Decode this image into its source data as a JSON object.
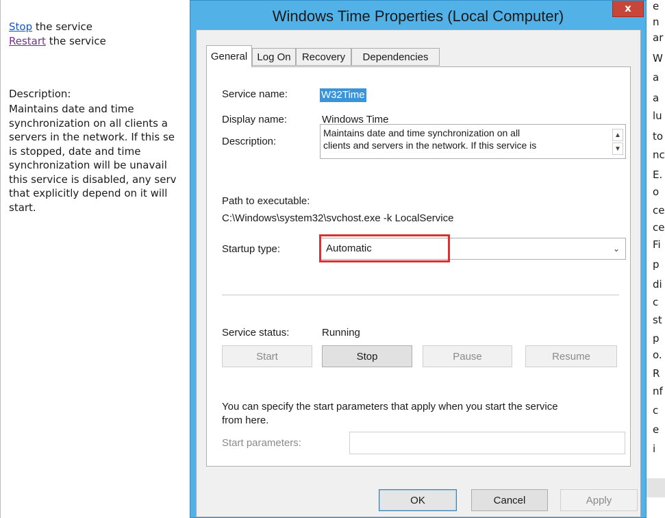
{
  "left_pane": {
    "stop_link": "Stop",
    "stop_suffix": " the service",
    "restart_link": "Restart",
    "restart_suffix": " the service",
    "description_label": "Description:",
    "description_lines": [
      "Maintains date and time",
      "synchronization on all clients a",
      "servers in the network. If this se",
      "is stopped, date and time",
      "synchronization will be unavail",
      "this service is disabled, any serv",
      "that explicitly depend on it will",
      "start."
    ]
  },
  "right_pane": {
    "fragments": [
      "e",
      "n",
      "ar",
      "W",
      "a",
      "a",
      "lu",
      "to",
      "nc",
      "E.",
      "o",
      "ce",
      "ce",
      "Fi",
      "p",
      "di",
      "c",
      "st",
      "p",
      "o.",
      "R",
      "nf",
      "c",
      "e",
      "i"
    ]
  },
  "dialog": {
    "title": "Windows Time Properties (Local Computer)",
    "close_glyph": "x",
    "tabs": [
      {
        "label": "General",
        "active": true
      },
      {
        "label": "Log On",
        "active": false
      },
      {
        "label": "Recovery",
        "active": false
      },
      {
        "label": "Dependencies",
        "active": false
      }
    ],
    "general": {
      "service_name_label": "Service name:",
      "service_name_value": "W32Time",
      "display_name_label": "Display name:",
      "display_name_value": "Windows Time",
      "description_label": "Description:",
      "description_lines": [
        "Maintains date and time synchronization on all",
        "clients and servers in the network. If this service is"
      ],
      "path_label": "Path to executable:",
      "path_value": "C:\\Windows\\system32\\svchost.exe -k LocalService",
      "startup_label": "Startup type:",
      "startup_value": "Automatic",
      "status_label": "Service status:",
      "status_value": "Running",
      "buttons": {
        "start": "Start",
        "stop": "Stop",
        "pause": "Pause",
        "resume": "Resume"
      },
      "help_text_lines": [
        "You can specify the start parameters that apply when you start the service",
        "from here."
      ],
      "start_params_label": "Start parameters:",
      "start_params_value": ""
    },
    "footer": {
      "ok": "OK",
      "cancel": "Cancel",
      "apply": "Apply"
    }
  },
  "colors": {
    "title_bar": "#52b2e8",
    "close_button": "#c7463a",
    "selection": "#3a94d9",
    "highlight": "#d83035",
    "link": "#1155cc",
    "visited_link": "#7b2c8f"
  }
}
